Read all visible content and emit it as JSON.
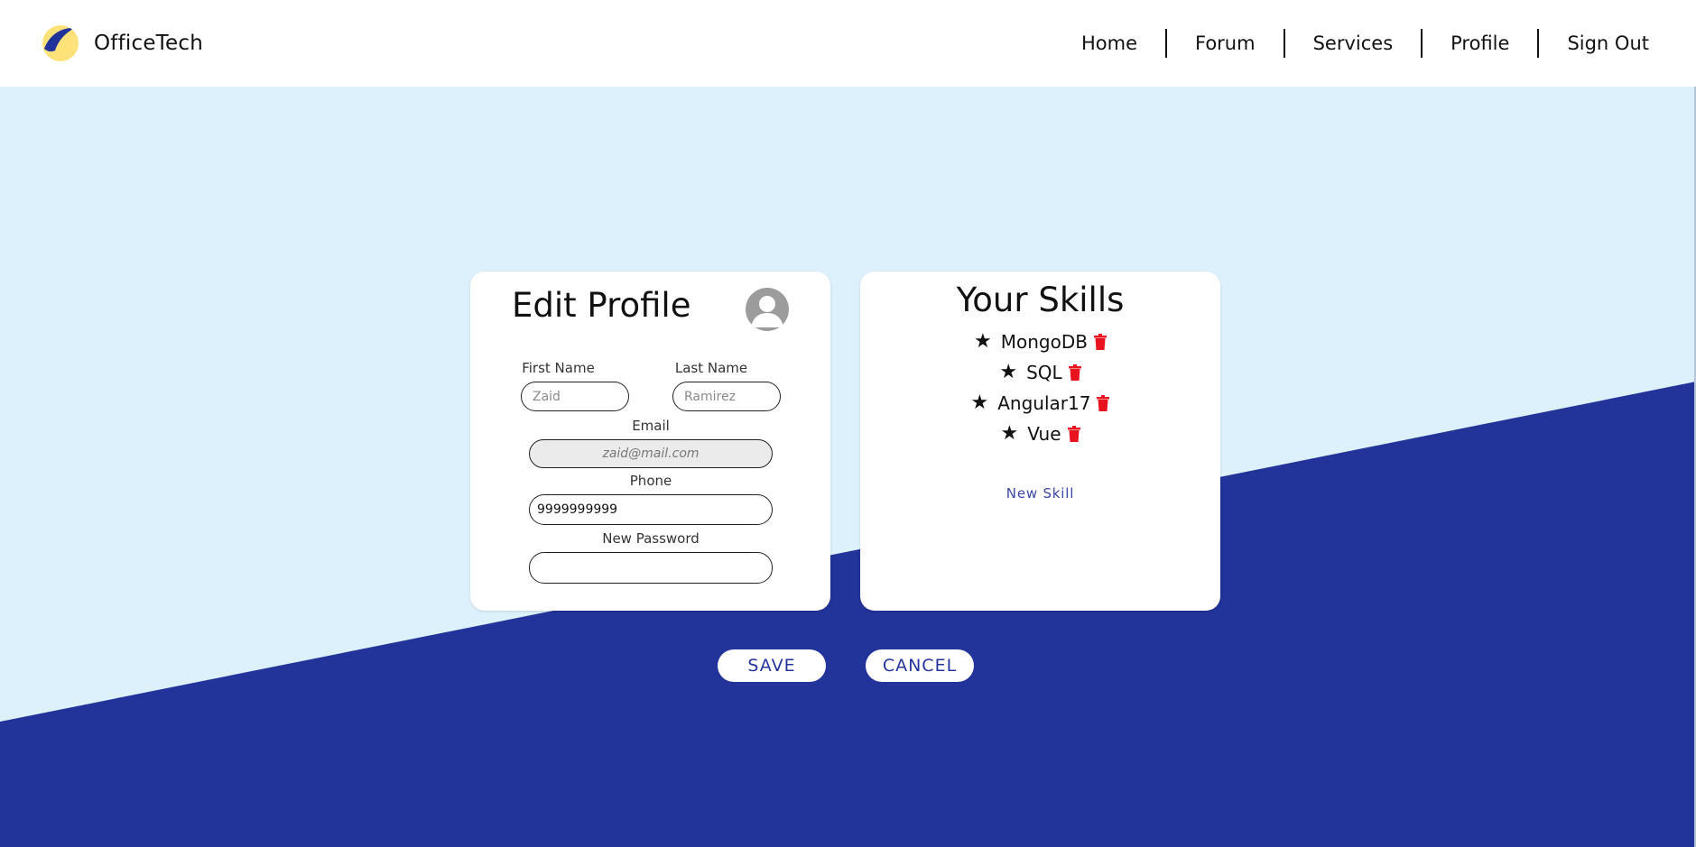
{
  "brand": {
    "name": "OfficeTech",
    "logo_icon": "swoosh-logo-icon"
  },
  "nav": {
    "items": [
      {
        "label": "Home"
      },
      {
        "label": "Forum"
      },
      {
        "label": "Services"
      },
      {
        "label": "Profile"
      },
      {
        "label": "Sign Out"
      }
    ]
  },
  "edit_profile": {
    "title": "Edit Profile",
    "avatar_icon": "user-avatar-icon",
    "first_name": {
      "label": "First Name",
      "placeholder": "Zaid",
      "value": ""
    },
    "last_name": {
      "label": "Last Name",
      "placeholder": "Ramirez",
      "value": ""
    },
    "email": {
      "label": "Email",
      "placeholder": "zaid@mail.com",
      "value": ""
    },
    "phone": {
      "label": "Phone",
      "placeholder": "",
      "value": "9999999999"
    },
    "new_password": {
      "label": "New Password",
      "placeholder": "",
      "value": ""
    }
  },
  "skills": {
    "title": "Your Skills",
    "items": [
      {
        "label": "MongoDB"
      },
      {
        "label": "SQL"
      },
      {
        "label": "Angular17"
      },
      {
        "label": "Vue"
      }
    ],
    "new_skill_label": "New Skill",
    "item_icon": "star-icon",
    "delete_icon": "trash-icon"
  },
  "actions": {
    "save_label": "SAVE",
    "cancel_label": "CANCEL"
  },
  "colors": {
    "background_light": "#ddf1fc",
    "background_dark": "#223399",
    "accent": "#26349e",
    "logo_yellow": "#fde27a",
    "delete_red": "#e8131f"
  }
}
